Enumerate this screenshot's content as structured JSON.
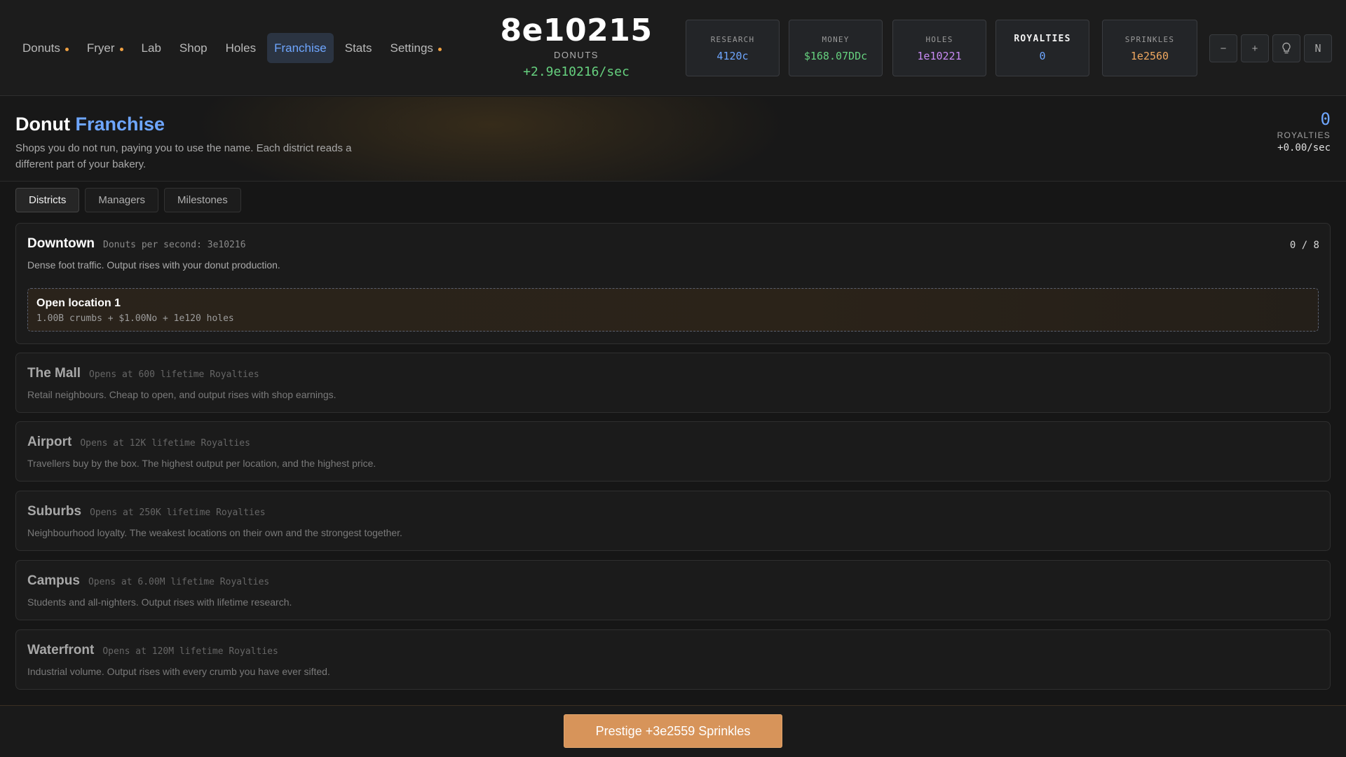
{
  "nav": {
    "items": [
      {
        "label": "Donuts",
        "dot": true,
        "active": false
      },
      {
        "label": "Fryer",
        "dot": true,
        "active": false
      },
      {
        "label": "Lab",
        "dot": false,
        "active": false
      },
      {
        "label": "Shop",
        "dot": false,
        "active": false
      },
      {
        "label": "Holes",
        "dot": false,
        "active": false
      },
      {
        "label": "Franchise",
        "dot": false,
        "active": true
      },
      {
        "label": "Stats",
        "dot": false,
        "active": false
      },
      {
        "label": "Settings",
        "dot": true,
        "active": false
      }
    ]
  },
  "donuts": {
    "count": "8e10215",
    "label": "DONUTS",
    "rate": "+2.9e10216/sec"
  },
  "resources": {
    "research": {
      "title": "RESEARCH",
      "value": "4120c",
      "color": "#6ea6ff"
    },
    "money": {
      "title": "MONEY",
      "value": "$168.07DDc",
      "color": "#66d17f"
    },
    "holes": {
      "title": "HOLES",
      "value": "1e10221",
      "color": "#c98bf5"
    },
    "royalties": {
      "title": "ROYALTIES",
      "value": "0",
      "color": "#6ea6ff"
    },
    "sprinkles": {
      "title": "SPRINKLES",
      "value": "1e2560",
      "color": "#f0a860"
    }
  },
  "controls": {
    "minus": "−",
    "plus": "+",
    "hint_icon": "lightbulb-icon",
    "notation": "N"
  },
  "page": {
    "title_main": "Donut",
    "title_accent": "Franchise",
    "description": "Shops you do not run, paying you to use the name. Each district reads a different part of your bakery.",
    "royalties_value": "0",
    "royalties_label": "ROYALTIES",
    "royalties_rate": "+0.00/sec"
  },
  "tabs": [
    "Districts",
    "Managers",
    "Milestones"
  ],
  "districts": [
    {
      "name": "Downtown",
      "meta": "Donuts per second: 3e10216",
      "desc": "Dense foot traffic. Output rises with your donut production.",
      "count": "0 / 8",
      "open_title": "Open location 1",
      "open_cost": "1.00B crumbs + $1.00No + 1e120 holes"
    },
    {
      "name": "The Mall",
      "meta": "Opens at 600 lifetime Royalties",
      "desc": "Retail neighbours. Cheap to open, and output rises with shop earnings."
    },
    {
      "name": "Airport",
      "meta": "Opens at 12K lifetime Royalties",
      "desc": "Travellers buy by the box. The highest output per location, and the highest price."
    },
    {
      "name": "Suburbs",
      "meta": "Opens at 250K lifetime Royalties",
      "desc": "Neighbourhood loyalty. The weakest locations on their own and the strongest together."
    },
    {
      "name": "Campus",
      "meta": "Opens at 6.00M lifetime Royalties",
      "desc": "Students and all-nighters. Output rises with lifetime research."
    },
    {
      "name": "Waterfront",
      "meta": "Opens at 120M lifetime Royalties",
      "desc": "Industrial volume. Output rises with every crumb you have ever sifted."
    }
  ],
  "footer": {
    "prestige_label": "Prestige +3e2559 Sprinkles"
  }
}
